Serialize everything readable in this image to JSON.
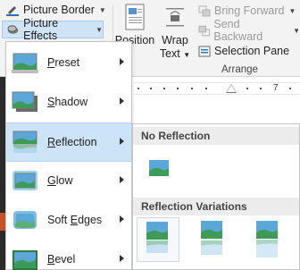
{
  "ribbon": {
    "picture_border": "Picture Border",
    "picture_effects": "Picture Effects",
    "position": "Position",
    "wrap_text_line1": "Wrap",
    "wrap_text_line2": "Text",
    "bring_forward": "Bring Forward",
    "send_backward": "Send Backward",
    "selection_pane": "Selection Pane",
    "arrange_group": "Arrange"
  },
  "ruler": {
    "mark": "6",
    "mark2": "7"
  },
  "menu": {
    "items": [
      {
        "pre": "",
        "key": "P",
        "post": "reset"
      },
      {
        "pre": "",
        "key": "S",
        "post": "hadow"
      },
      {
        "pre": "",
        "key": "R",
        "post": "eflection"
      },
      {
        "pre": "",
        "key": "G",
        "post": "low"
      },
      {
        "pre": "Soft ",
        "key": "E",
        "post": "dges"
      },
      {
        "pre": "",
        "key": "B",
        "post": "evel"
      }
    ],
    "active_index": 2
  },
  "submenu": {
    "no_reflection_header": "No Reflection",
    "variations_header": "Reflection Variations"
  },
  "colors": {
    "menu_highlight": "#cde3f8",
    "ribbon_bg": "#f3f3f3",
    "thumb_sky": "#5aa7d8",
    "thumb_grass": "#3f9a58"
  }
}
